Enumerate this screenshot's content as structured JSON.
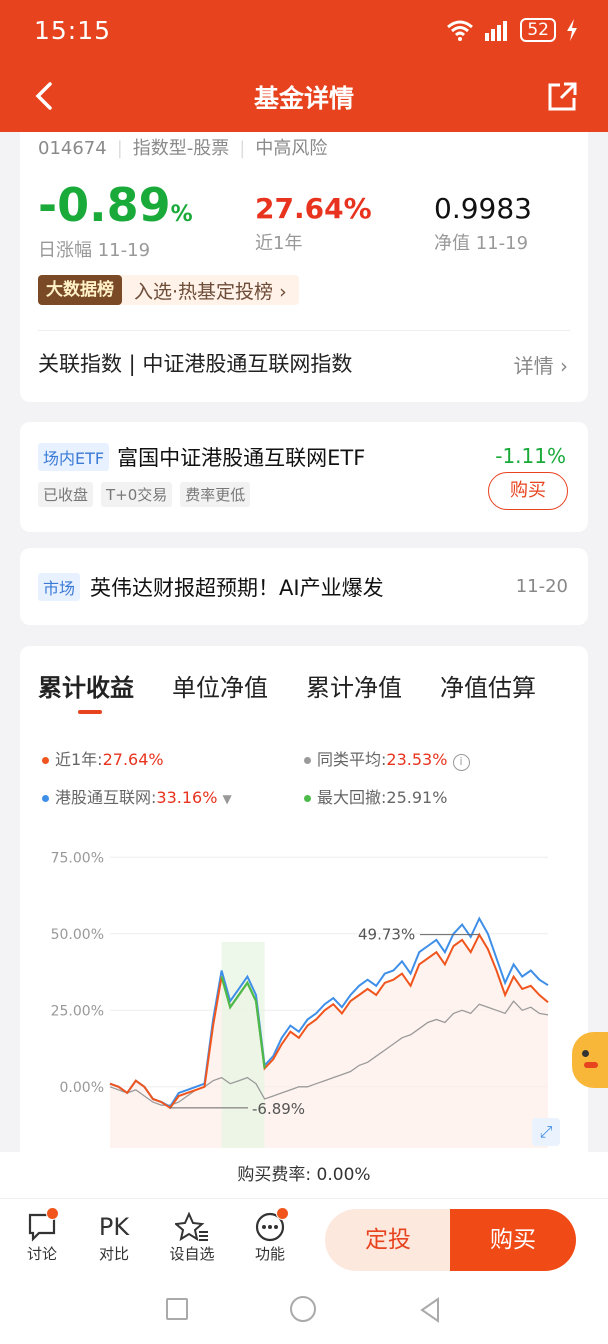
{
  "status": {
    "time": "15:15",
    "battery": "52"
  },
  "nav": {
    "title": "基金详情"
  },
  "fund": {
    "code": "014674",
    "type": "指数型-股票",
    "risk": "中高风险",
    "daily_change_num": "-0.89",
    "daily_change_unit": "%",
    "daily_label": "日涨幅 11-19",
    "year_return": "27.64%",
    "year_label": "近1年",
    "nav_value": "0.9983",
    "nav_label": "净值 11-19",
    "badge_dark": "大数据榜",
    "badge_text": "入选·热基定投榜 ›",
    "assoc_index": "关联指数 | 中证港股通互联网指数",
    "detail": "详情 ›"
  },
  "etf": {
    "tag": "场内ETF",
    "name": "富国中证港股通互联网ETF",
    "change": "-1.11%",
    "tags": [
      "已收盘",
      "T+0交易",
      "费率更低"
    ],
    "buy": "购买"
  },
  "news": {
    "tag": "市场",
    "title": "英伟达财报超预期！AI产业爆发",
    "date": "11-20"
  },
  "tabs": [
    "累计收益",
    "单位净值",
    "累计净值",
    "净值估算"
  ],
  "legend": {
    "fund_label": "近1年:",
    "fund_value": "27.64%",
    "peer_label": "同类平均:",
    "peer_value": "23.53%",
    "index_label": "港股通互联网:",
    "index_value": "33.16%",
    "dd_label": "最大回撤:",
    "dd_value": "25.91%"
  },
  "colors": {
    "fund": "#f0551d",
    "index": "#3f8fe8",
    "peer": "#9a9a9a",
    "drawdown": "#4cbb4a"
  },
  "chart_data": {
    "type": "line",
    "ylim": [
      -20,
      80
    ],
    "yticks": [
      "75.00%",
      "50.00%",
      "25.00%",
      "0.00%"
    ],
    "ytick_values": [
      75,
      50,
      25,
      0
    ],
    "annotations": [
      {
        "text": "49.73%",
        "value": 49.73
      },
      {
        "text": "-6.89%",
        "value": -6.89
      }
    ],
    "series": [
      {
        "name": "近1年",
        "values": [
          1,
          0,
          -2,
          2,
          0,
          -4,
          -5,
          -6.9,
          -3,
          -2,
          -1,
          0,
          20,
          36,
          26,
          30,
          34,
          28,
          6,
          9,
          14,
          18,
          16,
          20,
          22,
          25,
          27,
          24,
          28,
          30,
          32,
          30,
          34,
          35,
          37,
          33,
          40,
          42,
          44,
          40,
          46,
          48,
          44,
          49.7,
          45,
          38,
          30,
          36,
          32,
          33,
          30,
          27.6
        ]
      },
      {
        "name": "港股通互联网",
        "values": [
          1,
          0,
          -2,
          2,
          0,
          -4,
          -5,
          -6.5,
          -2,
          -1,
          0,
          1,
          22,
          38,
          28,
          32,
          36,
          30,
          7,
          10,
          16,
          20,
          18,
          22,
          24,
          27,
          29,
          26,
          30,
          33,
          35,
          33,
          37,
          38,
          41,
          37,
          44,
          46,
          48,
          44,
          50,
          53,
          49,
          55,
          50,
          42,
          34,
          40,
          36,
          38,
          35,
          33.2
        ]
      },
      {
        "name": "同类平均",
        "values": [
          0,
          -1,
          -2,
          -1,
          -3,
          -5,
          -6,
          -6,
          -5,
          -3,
          -1,
          0,
          2,
          3,
          1,
          2,
          3,
          1,
          -4,
          -3,
          -2,
          -1,
          0,
          0,
          1,
          2,
          3,
          4,
          5,
          7,
          8,
          10,
          12,
          14,
          16,
          17,
          19,
          21,
          22,
          21,
          24,
          25,
          24,
          27,
          26,
          25,
          24,
          28,
          25,
          26,
          24,
          23.5
        ]
      }
    ]
  },
  "fee": "购买费率: 0.00%",
  "bottom": {
    "items": [
      {
        "label": "讨论"
      },
      {
        "label": "对比",
        "icon_text": "PK"
      },
      {
        "label": "设自选"
      },
      {
        "label": "功能"
      }
    ],
    "dingtou": "定投",
    "buy": "购买"
  }
}
